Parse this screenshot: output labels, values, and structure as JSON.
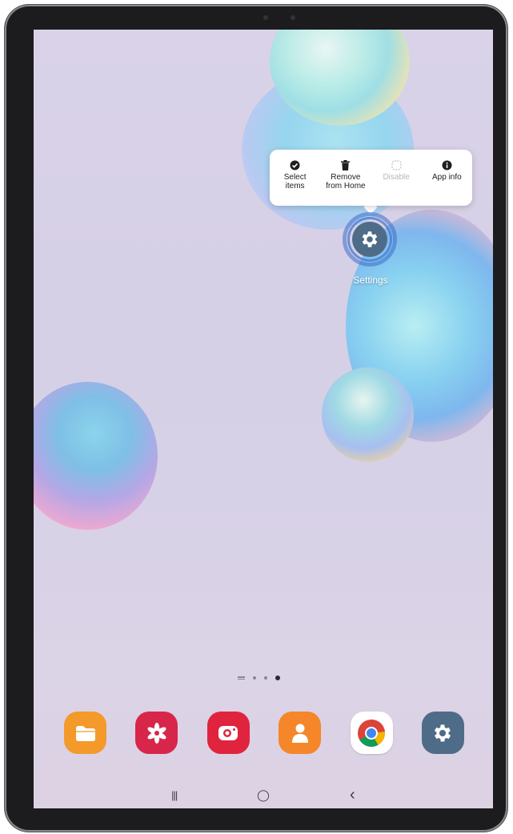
{
  "context_menu": {
    "items": [
      {
        "label": "Select\nitems",
        "icon": "check-circle-icon",
        "enabled": true
      },
      {
        "label": "Remove\nfrom Home",
        "icon": "trash-icon",
        "enabled": true
      },
      {
        "label": "Disable",
        "icon": "disable-icon",
        "enabled": false
      },
      {
        "label": "App info",
        "icon": "info-icon",
        "enabled": true
      }
    ]
  },
  "home_app": {
    "label": "Settings",
    "icon": "gear-icon",
    "color": "#4e6c88"
  },
  "page_indicator": {
    "pages": 3,
    "current": 3
  },
  "dock": {
    "apps": [
      {
        "name": "My Files",
        "icon": "folder-icon",
        "color": "#f39a2b"
      },
      {
        "name": "Galaxy Store",
        "icon": "flower-icon",
        "color": "#d8264a"
      },
      {
        "name": "Screen Recorder",
        "icon": "camera-icon",
        "color": "#e0243e"
      },
      {
        "name": "Contacts",
        "icon": "person-icon",
        "color": "#f5862a"
      },
      {
        "name": "Chrome",
        "icon": "chrome-icon",
        "color": "#ffffff"
      },
      {
        "name": "Settings",
        "icon": "gear-icon",
        "color": "#4e6c88"
      }
    ]
  },
  "navbar": {
    "recents": "|||",
    "home": "◯",
    "back": "‹"
  }
}
